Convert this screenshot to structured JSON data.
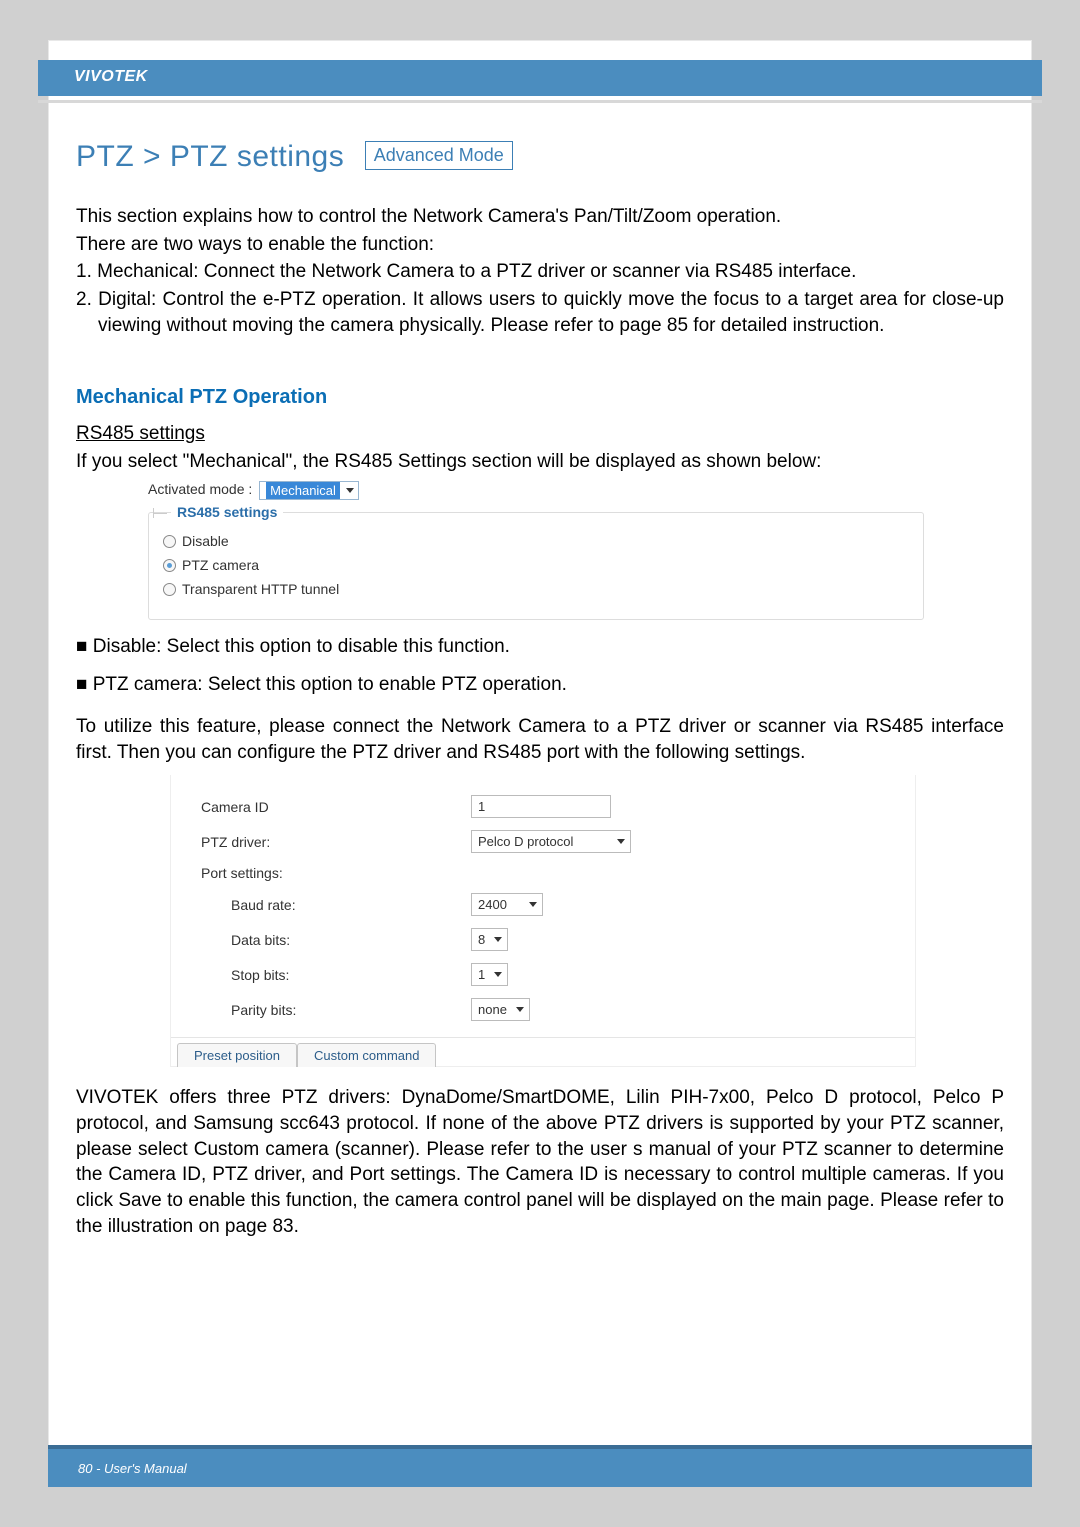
{
  "brand": "VIVOTEK",
  "page_title": "PTZ > PTZ settings",
  "adv_badge": "Advanced Mode",
  "intro_p1": "This section explains how to control the Network Camera's Pan/Tilt/Zoom operation.",
  "intro_p2": "There are two ways to enable the function:",
  "intro_l1": "1. Mechanical: Connect the Network Camera to a PTZ driver or scanner via RS485 interface.",
  "intro_l2": "2. Digital: Control the e-PTZ operation. It allows users to quickly move the focus to a target area for close-up viewing without moving the camera physically. Please refer to page 85 for detailed instruction.",
  "section_head": "Mechanical PTZ Operation",
  "rs485_link": "RS485 settings",
  "rs485_expl": "If you select \"Mechanical\", the RS485 Settings section will be displayed as shown below:",
  "activated_label": "Activated mode :",
  "activated_value": "Mechanical",
  "rs485_legend": "RS485 settings",
  "radios": {
    "disable": "Disable",
    "ptz": "PTZ camera",
    "tunnel": "Transparent HTTP tunnel"
  },
  "b1": "■ Disable: Select this option to disable this function.",
  "b2": "■ PTZ camera: Select this option to enable PTZ operation.",
  "para_conn": "To utilize this feature, please connect the Network Camera to a PTZ driver or scanner via RS485 interface first. Then you can configure the PTZ driver and RS485 port with the following settings.",
  "settings": {
    "camera_id_label": "Camera ID",
    "camera_id_value": "1",
    "ptz_driver_label": "PTZ driver:",
    "ptz_driver_value": "Pelco D protocol",
    "port_label": "Port settings:",
    "baud_label": "Baud rate:",
    "baud_value": "2400",
    "data_label": "Data bits:",
    "data_value": "8",
    "stop_label": "Stop bits:",
    "stop_value": "1",
    "parity_label": "Parity bits:",
    "parity_value": "none"
  },
  "tabs": {
    "preset": "Preset position",
    "custom": "Custom command"
  },
  "para_drivers": "VIVOTEK offers three PTZ drivers: DynaDome/SmartDOME, Lilin PIH-7x00, Pelco D protocol, Pelco P protocol, and Samsung scc643 protocol. If none of the above PTZ drivers is supported by your PTZ scanner, please select Custom camera  (scanner). Please refer to the user s manual of your PTZ scanner to determine the Camera ID, PTZ driver, and Port settings. The Camera ID is necessary to control multiple cameras. If you click Save to enable this function, the camera control panel will be displayed on the main page. Please refer to the illustration on page 83.",
  "footer": "80 - User's Manual"
}
